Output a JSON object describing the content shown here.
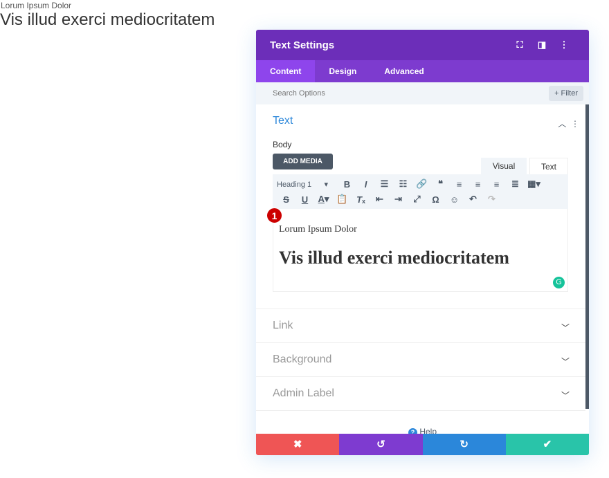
{
  "preview": {
    "small": "Lorum Ipsum Dolor",
    "big": "Vis illud exerci mediocritatem"
  },
  "panel": {
    "title": "Text Settings",
    "tabs": [
      {
        "label": "Content"
      },
      {
        "label": "Design"
      },
      {
        "label": "Advanced"
      }
    ],
    "search_placeholder": "Search Options",
    "filter_label": "+ Filter",
    "text_section": {
      "title": "Text",
      "body_label": "Body",
      "add_media": "ADD MEDIA",
      "visual_tab": "Visual",
      "text_tab": "Text",
      "format": "Heading 1",
      "content_line1": "Lorum Ipsum Dolor",
      "content_line2": "Vis illud exerci mediocritatem",
      "marker": "1"
    },
    "sections": [
      {
        "label": "Link"
      },
      {
        "label": "Background"
      },
      {
        "label": "Admin Label"
      }
    ],
    "help": "Help",
    "colors": {
      "header": "#6c2eb9",
      "cancel": "#ef5555",
      "undo": "#7e3bd0",
      "redo": "#2b87da",
      "save": "#29c4a9"
    }
  }
}
